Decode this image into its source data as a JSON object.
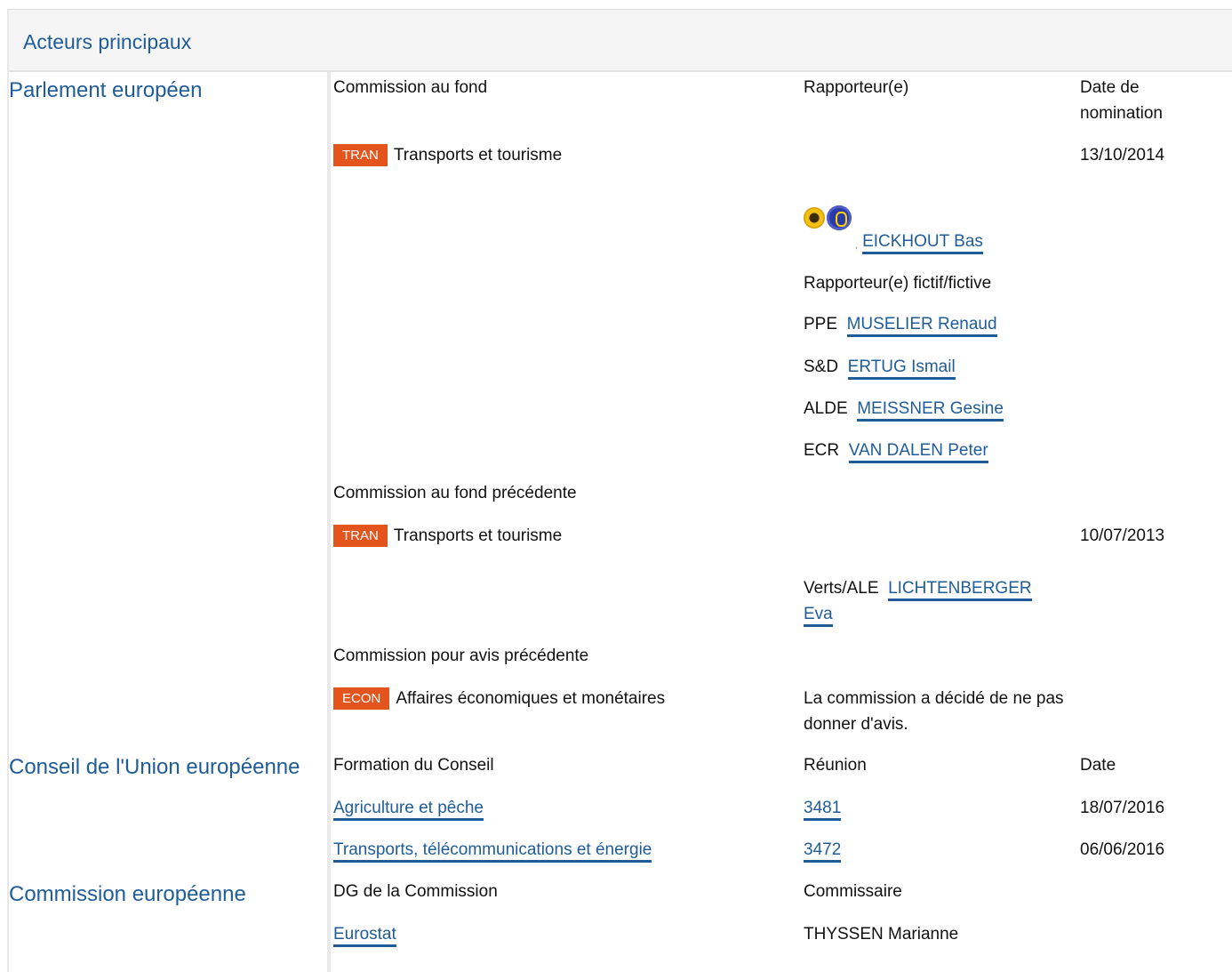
{
  "header": {
    "title": "Acteurs principaux"
  },
  "parliament": {
    "label": "Parlement européen",
    "col_committee": "Commission au fond",
    "col_rapporteur": "Rapporteur(e)",
    "col_date": "Date de nomination",
    "committee": {
      "badge": "TRAN",
      "name": "Transports et tourisme",
      "date": "13/10/2014"
    },
    "rapporteur": {
      "name": "EICKHOUT Bas",
      "group_logo": "greens-efa-logo"
    },
    "shadow_label": "Rapporteur(e) fictif/fictive",
    "shadows": [
      {
        "group": "PPE",
        "name": "MUSELIER Renaud"
      },
      {
        "group": "S&D",
        "name": "ERTUG Ismail"
      },
      {
        "group": "ALDE",
        "name": "MEISSNER Gesine"
      },
      {
        "group": "ECR",
        "name": "VAN DALEN Peter"
      }
    ],
    "previous_label": "Commission au fond précédente",
    "previous": {
      "badge": "TRAN",
      "name": "Transports et tourisme",
      "date": "10/07/2013",
      "group": "Verts/ALE",
      "rapporteur_line1": "LICHTENBERGER",
      "rapporteur_line2": "Eva"
    },
    "opinion_label": "Commission pour avis précédente",
    "opinion": {
      "badge": "ECON",
      "name": "Affaires économiques et monétaires",
      "note": "La commission a décidé de ne pas donner d'avis."
    }
  },
  "council": {
    "label": "Conseil de l'Union européenne",
    "col_formation": "Formation du Conseil",
    "col_meeting": "Réunion",
    "col_date": "Date",
    "rows": [
      {
        "formation": "Agriculture et pêche",
        "meeting": "3481",
        "date": "18/07/2016"
      },
      {
        "formation": "Transports, télécommunications et énergie",
        "meeting": "3472",
        "date": "06/06/2016"
      }
    ]
  },
  "commission": {
    "label": "Commission européenne",
    "col_dg": "DG de la Commission",
    "col_commissioner": "Commissaire",
    "dg": "Eurostat",
    "commissioner": "THYSSEN Marianne"
  }
}
